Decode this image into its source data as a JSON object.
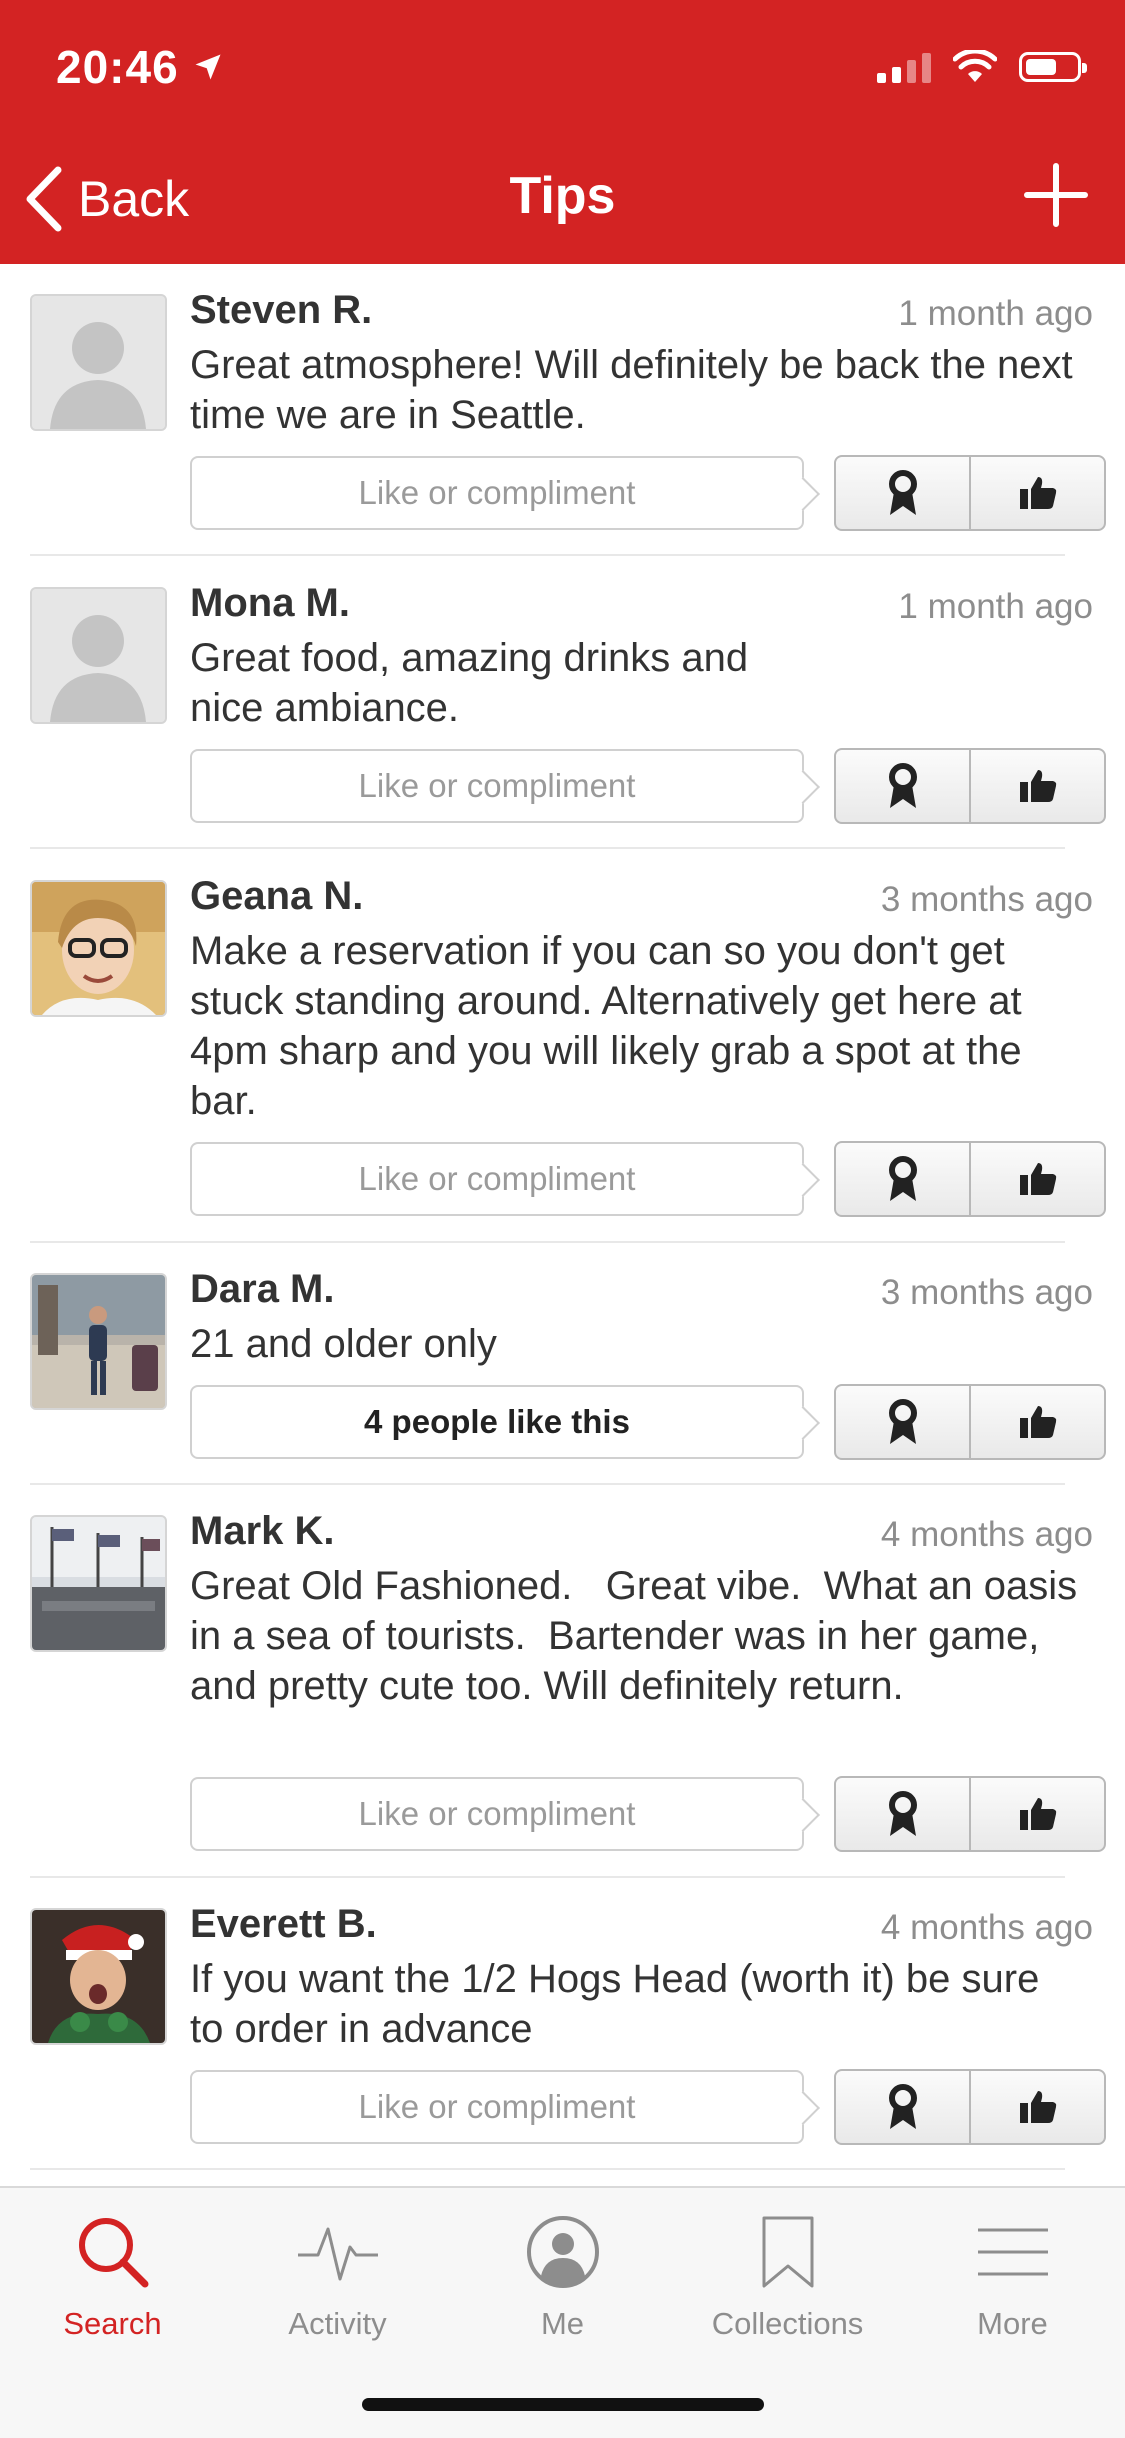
{
  "status": {
    "time": "20:46"
  },
  "nav": {
    "back_label": "Back",
    "title": "Tips"
  },
  "tips": [
    {
      "name": "Steven R.",
      "time": "1 month ago",
      "text": "Great atmosphere! Will definitely be back the next time we are in Seattle.",
      "like": "Like or compliment"
    },
    {
      "name": "Mona M.",
      "time": "1 month ago",
      "text": "Great food, amazing drinks and nice ambiance.",
      "like": "Like or compliment"
    },
    {
      "name": "Geana N.",
      "time": "3 months ago",
      "text": "Make a reservation if you can so you don't get stuck standing around. Alternatively get here at 4pm sharp and you will likely grab a spot at the bar.",
      "like": "Like or compliment"
    },
    {
      "name": "Dara M.",
      "time": "3 months ago",
      "text": "21 and older only",
      "like": "4 people like this"
    },
    {
      "name": "Mark K.",
      "time": "4 months ago",
      "text": "Great Old Fashioned.   Great vibe.  What an oasis in a sea of tourists.  Bartender was in her game, and pretty cute too. Will definitely return.",
      "like": "Like or compliment"
    },
    {
      "name": "Everett B.",
      "time": "4 months ago",
      "text": "If you want the 1/2 Hogs Head (worth it) be sure to order in advance",
      "like": "Like or compliment"
    }
  ],
  "tabbar": {
    "items": [
      {
        "label": "Search",
        "icon": "search-icon",
        "active": true
      },
      {
        "label": "Activity",
        "icon": "activity-icon",
        "active": false
      },
      {
        "label": "Me",
        "icon": "profile-icon",
        "active": false
      },
      {
        "label": "Collections",
        "icon": "bookmark-icon",
        "active": false
      },
      {
        "label": "More",
        "icon": "menu-icon",
        "active": false
      }
    ]
  },
  "colors": {
    "brand": "#d32323",
    "muted": "#8d8d8d"
  }
}
